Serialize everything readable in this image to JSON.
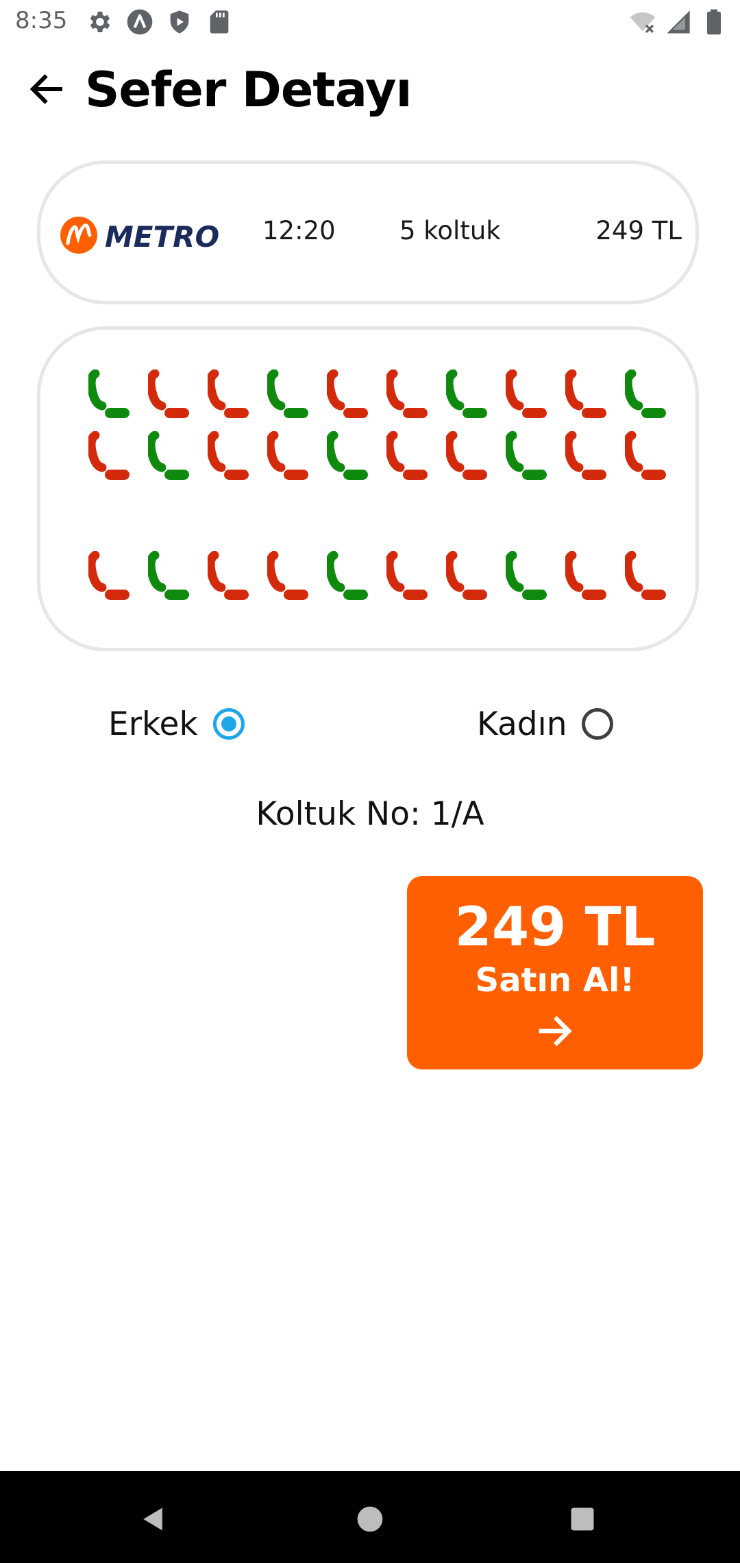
{
  "status_bar": {
    "time": "8:35",
    "left_icons": [
      "settings-icon",
      "app-icon",
      "shield-icon",
      "sd-card-icon"
    ],
    "right_icons": [
      "wifi-icon",
      "signal-icon",
      "battery-icon"
    ]
  },
  "header": {
    "back_icon": "arrow-back-icon",
    "title": "Sefer Detayı"
  },
  "trip": {
    "company": "METRO",
    "time": "12:20",
    "seats": "5 koltuk",
    "price": "249 TL"
  },
  "seat_map": {
    "colors": {
      "available": "#0f8a0f",
      "occupied": "#d32a0c"
    },
    "rows": [
      [
        "available",
        "occupied",
        "occupied",
        "available",
        "occupied",
        "occupied",
        "available",
        "occupied",
        "occupied",
        "available"
      ],
      [
        "occupied",
        "available",
        "occupied",
        "occupied",
        "available",
        "occupied",
        "occupied",
        "available",
        "occupied",
        "occupied"
      ],
      [
        "occupied",
        "available",
        "occupied",
        "occupied",
        "available",
        "occupied",
        "occupied",
        "available",
        "occupied",
        "occupied"
      ]
    ]
  },
  "gender": {
    "male_label": "Erkek",
    "female_label": "Kadın",
    "selected": "male"
  },
  "seat_number": "Koltuk No: 1/A",
  "buy": {
    "price": "249 TL",
    "label": "Satın Al!",
    "arrow_icon": "arrow-forward-icon",
    "color": "#ff5f00"
  },
  "nav": {
    "icons": [
      "nav-back-icon",
      "nav-home-icon",
      "nav-recents-icon"
    ]
  }
}
